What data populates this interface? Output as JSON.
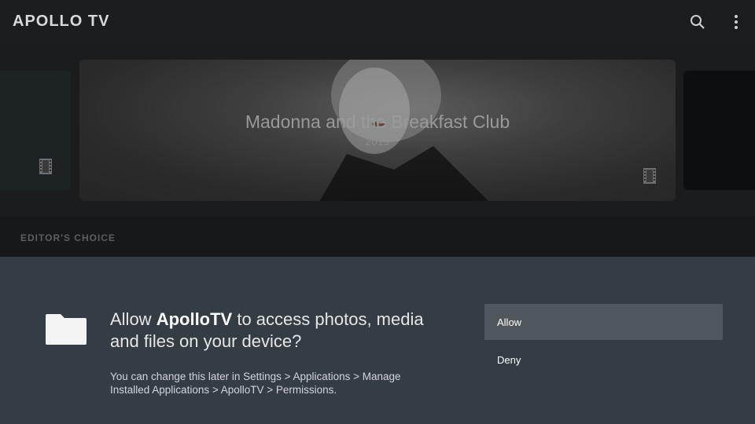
{
  "app": {
    "title": "APOLLO TV"
  },
  "header": {
    "icons": [
      "search-icon",
      "more-vert-icon"
    ]
  },
  "featured": {
    "title": "Madonna and the Breakfast Club",
    "year": "2019",
    "icon": "film-icon"
  },
  "section": {
    "label": "EDITOR'S CHOICE"
  },
  "dialog": {
    "icon": "folder-icon",
    "message_prefix": "Allow ",
    "app_name": "ApolloTV",
    "message_suffix": " to access photos, media and files on your device?",
    "subtext": "You can change this later in Settings > Applications > Manage Installed Applications > ApolloTV > Permissions.",
    "allow_label": "Allow",
    "deny_label": "Deny"
  },
  "colors": {
    "background": "#16181a",
    "dialog": "#343d44",
    "allow_highlight": "#4f565c"
  }
}
